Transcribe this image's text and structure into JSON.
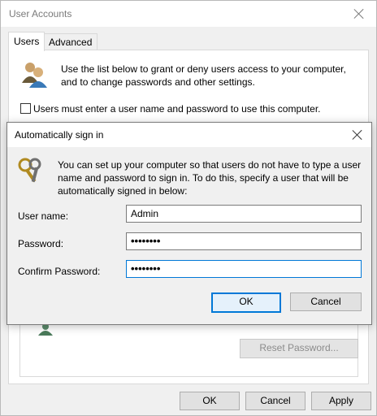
{
  "window": {
    "title": "User Accounts"
  },
  "tabs": [
    {
      "label": "Users"
    },
    {
      "label": "Advanced"
    }
  ],
  "users_tab": {
    "intro": "Use the list below to grant or deny users access to your computer, and to change passwords and other settings.",
    "checkbox_label": "Users must enter a user name and password to use this computer.",
    "checkbox_checked": false,
    "reset_password_label": "Reset Password..."
  },
  "footer": {
    "ok_label": "OK",
    "cancel_label": "Cancel",
    "apply_label": "Apply"
  },
  "dialog": {
    "title": "Automatically sign in",
    "description": "You can set up your computer so that users do not have to type a user name and password to sign in. To do this, specify a user that will be automatically signed in below:",
    "username_label": "User name:",
    "username_value": "Admin",
    "password_label": "Password:",
    "password_value": "••••••••",
    "confirm_label": "Confirm Password:",
    "confirm_value": "••••••••",
    "ok_label": "OK",
    "cancel_label": "Cancel"
  },
  "colors": {
    "accent": "#0078d7",
    "face": "#f0f0f0",
    "border": "#adadad"
  }
}
